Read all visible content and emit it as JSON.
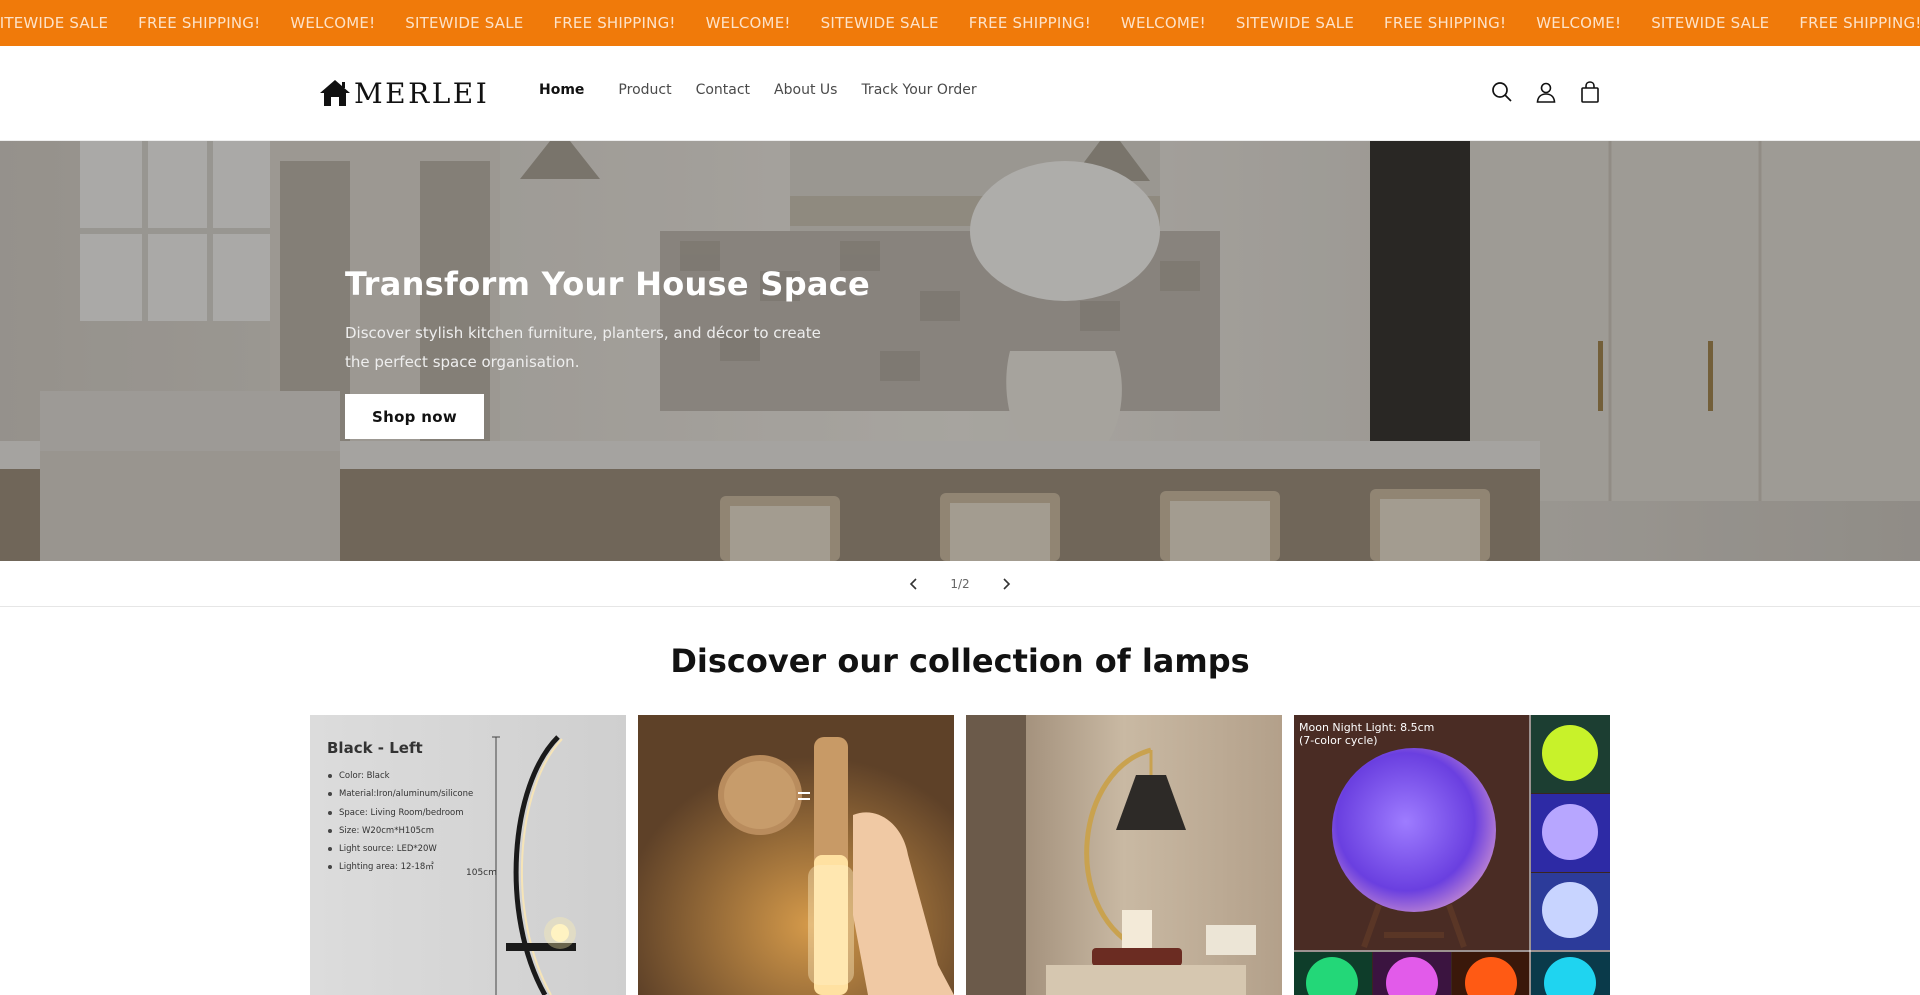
{
  "announcement": {
    "items": [
      "SITEWIDE SALE",
      "FREE SHIPPING!",
      "WELCOME!",
      "SITEWIDE SALE",
      "FREE SHIPPING!",
      "WELCOME!",
      "SITEWIDE SALE",
      "FREE SHIPPING!",
      "WELCOME!",
      "SITEWIDE SALE",
      "FREE SHIPPING!",
      "WELCOME!",
      "SITEWIDE SALE",
      "FREE SHIPPING!",
      "WELCOME!"
    ],
    "background": "#f07a0a"
  },
  "header": {
    "logo_text": "MERLEI",
    "nav": [
      "Home",
      "Product",
      "Contact",
      "About Us",
      "Track Your Order"
    ],
    "active_nav": "Home",
    "icons": [
      "search-icon",
      "account-icon",
      "cart-icon"
    ]
  },
  "hero": {
    "title": "Transform Your House Space",
    "subtitle": "Discover stylish kitchen furniture, planters, and décor to create the perfect space organisation.",
    "button_label": "Shop now"
  },
  "slider": {
    "counter": "1/2"
  },
  "collection": {
    "title": "Discover our collection of lamps",
    "card1": {
      "title": "Black - Left",
      "specs": [
        "Color: Black",
        "Material:Iron/aluminum/silicone",
        "Space: Living Room/bedroom",
        "Size: W20cm*H105cm",
        "Light source: LED*20W",
        "Lighting area: 12-18㎡"
      ],
      "dimension": "105cm"
    },
    "card4": {
      "label_line1": "Moon Night Light: 8.5cm",
      "label_line2": "(7-color cycle)"
    }
  }
}
